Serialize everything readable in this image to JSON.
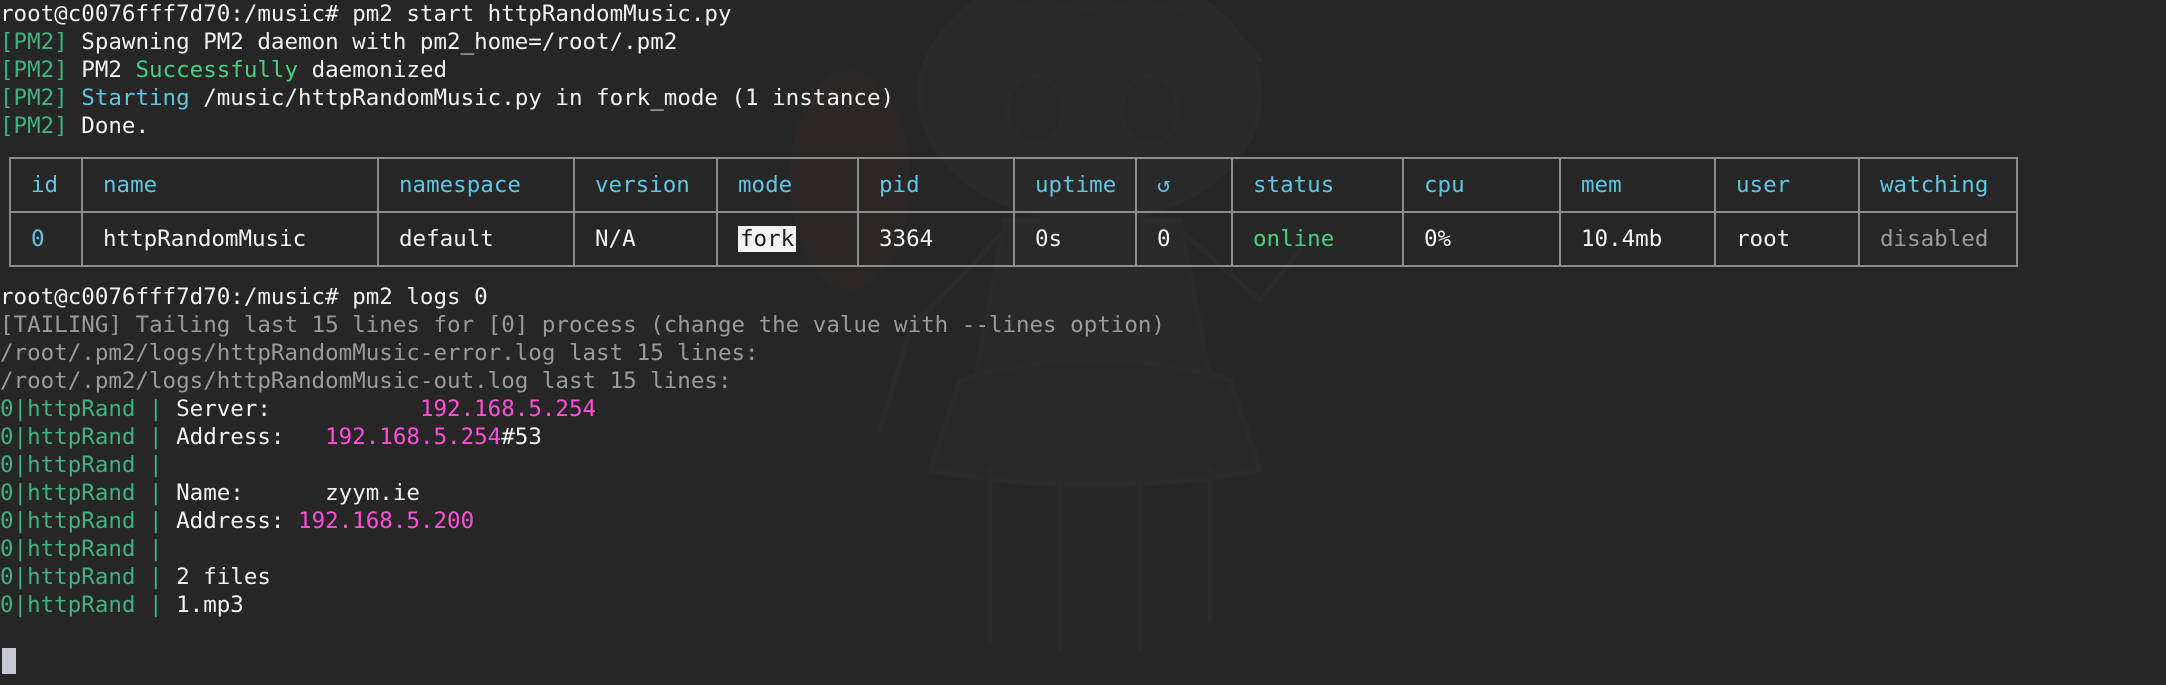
{
  "terminal": {
    "lines": {
      "l1": "root@c0076fff7d70:/music# pm2 start httpRandomMusic.py",
      "pm2_tag": "[PM2]",
      "l2_text": " Spawning PM2 daemon with pm2_home=/root/.pm2",
      "l3_a": " PM2 ",
      "l3_b": "Successfully",
      "l3_c": " daemonized",
      "l4_a": "Starting",
      "l4_b": " /music/httpRandomMusic.py in fork_mode (1 instance)",
      "l5_text": " Done.",
      "l7": "root@c0076fff7d70:/music# pm2 logs 0",
      "l8": "[TAILING] Tailing last 15 lines for [0] process (change the value with --lines option)",
      "l9": "/root/.pm2/logs/httpRandomMusic-error.log last 15 lines:",
      "l10": "/root/.pm2/logs/httpRandomMusic-out.log last 15 lines:",
      "log_prefix": "0|httpRand | ",
      "log1_label": "Server:           ",
      "log1_value": "192.168.5.254",
      "log2_label": "Address:   ",
      "log2_value": "192.168.5.254",
      "log2_suffix": "#53",
      "log4_text": "Name:      zyym.ie",
      "log5_label": "Address: ",
      "log5_value": "192.168.5.200",
      "log7_text": "2 files",
      "log8_text": "1.mp3"
    },
    "table": {
      "headers": [
        "id",
        "name",
        "namespace",
        "version",
        "mode",
        "pid",
        "uptime",
        "↺",
        "status",
        "cpu",
        "mem",
        "user",
        "watching"
      ],
      "row": [
        "0",
        "httpRandomMusic",
        "default",
        "N/A",
        "fork",
        "3364",
        "0s",
        "0",
        "online",
        "0%",
        "10.4mb",
        "root",
        "disabled"
      ]
    }
  },
  "colors": {
    "background": "#262626",
    "pm2_tag": "#3fb27f",
    "header": "#5fc5e0",
    "ip": "#ff4fd8",
    "muted": "#9a9a9a",
    "online": "#45d27f"
  },
  "icons": {
    "cursor": "block-cursor-icon",
    "restart": "restart-icon"
  }
}
